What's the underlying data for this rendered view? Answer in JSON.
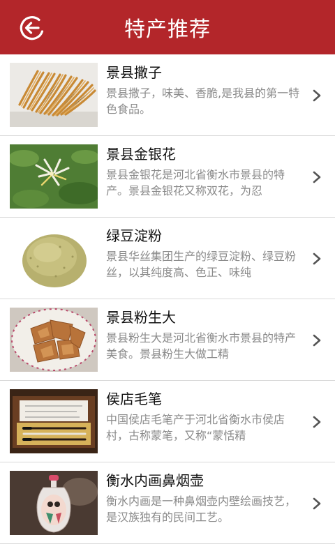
{
  "header": {
    "title": "特产推荐",
    "back_icon": "back-arrow-circle-icon",
    "color": "#b3262a"
  },
  "items": [
    {
      "name": "景县撒子",
      "desc": "景县撒子，味美、香脆,是我县的第一特色食品。",
      "image": "fried-dough-strips"
    },
    {
      "name": "景县金银花",
      "desc": "景县金银花是河北省衡水市景县的特产。景县金银花又称双花，为忍",
      "image": "honeysuckle-flowers"
    },
    {
      "name": "绿豆淀粉",
      "desc": "景县华丝集团生产的绿豆淀粉、绿豆粉丝，以其纯度高、色正、味纯",
      "image": "mung-bean-starch-powder"
    },
    {
      "name": "景县粉生大",
      "desc": "景县粉生大是河北省衡水市景县的特产美食。景县粉生大做工精",
      "image": "fried-pastry-plate"
    },
    {
      "name": "侯店毛笔",
      "desc": "中国侯店毛笔产于河北省衡水市侯店村，古称蒙笔，又称“蒙恬精",
      "image": "writing-brush-box"
    },
    {
      "name": "衡水内画鼻烟壶",
      "desc": "衡水内画是一种鼻烟壶内壁绘画技艺，是汉族独有的民间工艺。",
      "image": "snuff-bottle"
    }
  ]
}
